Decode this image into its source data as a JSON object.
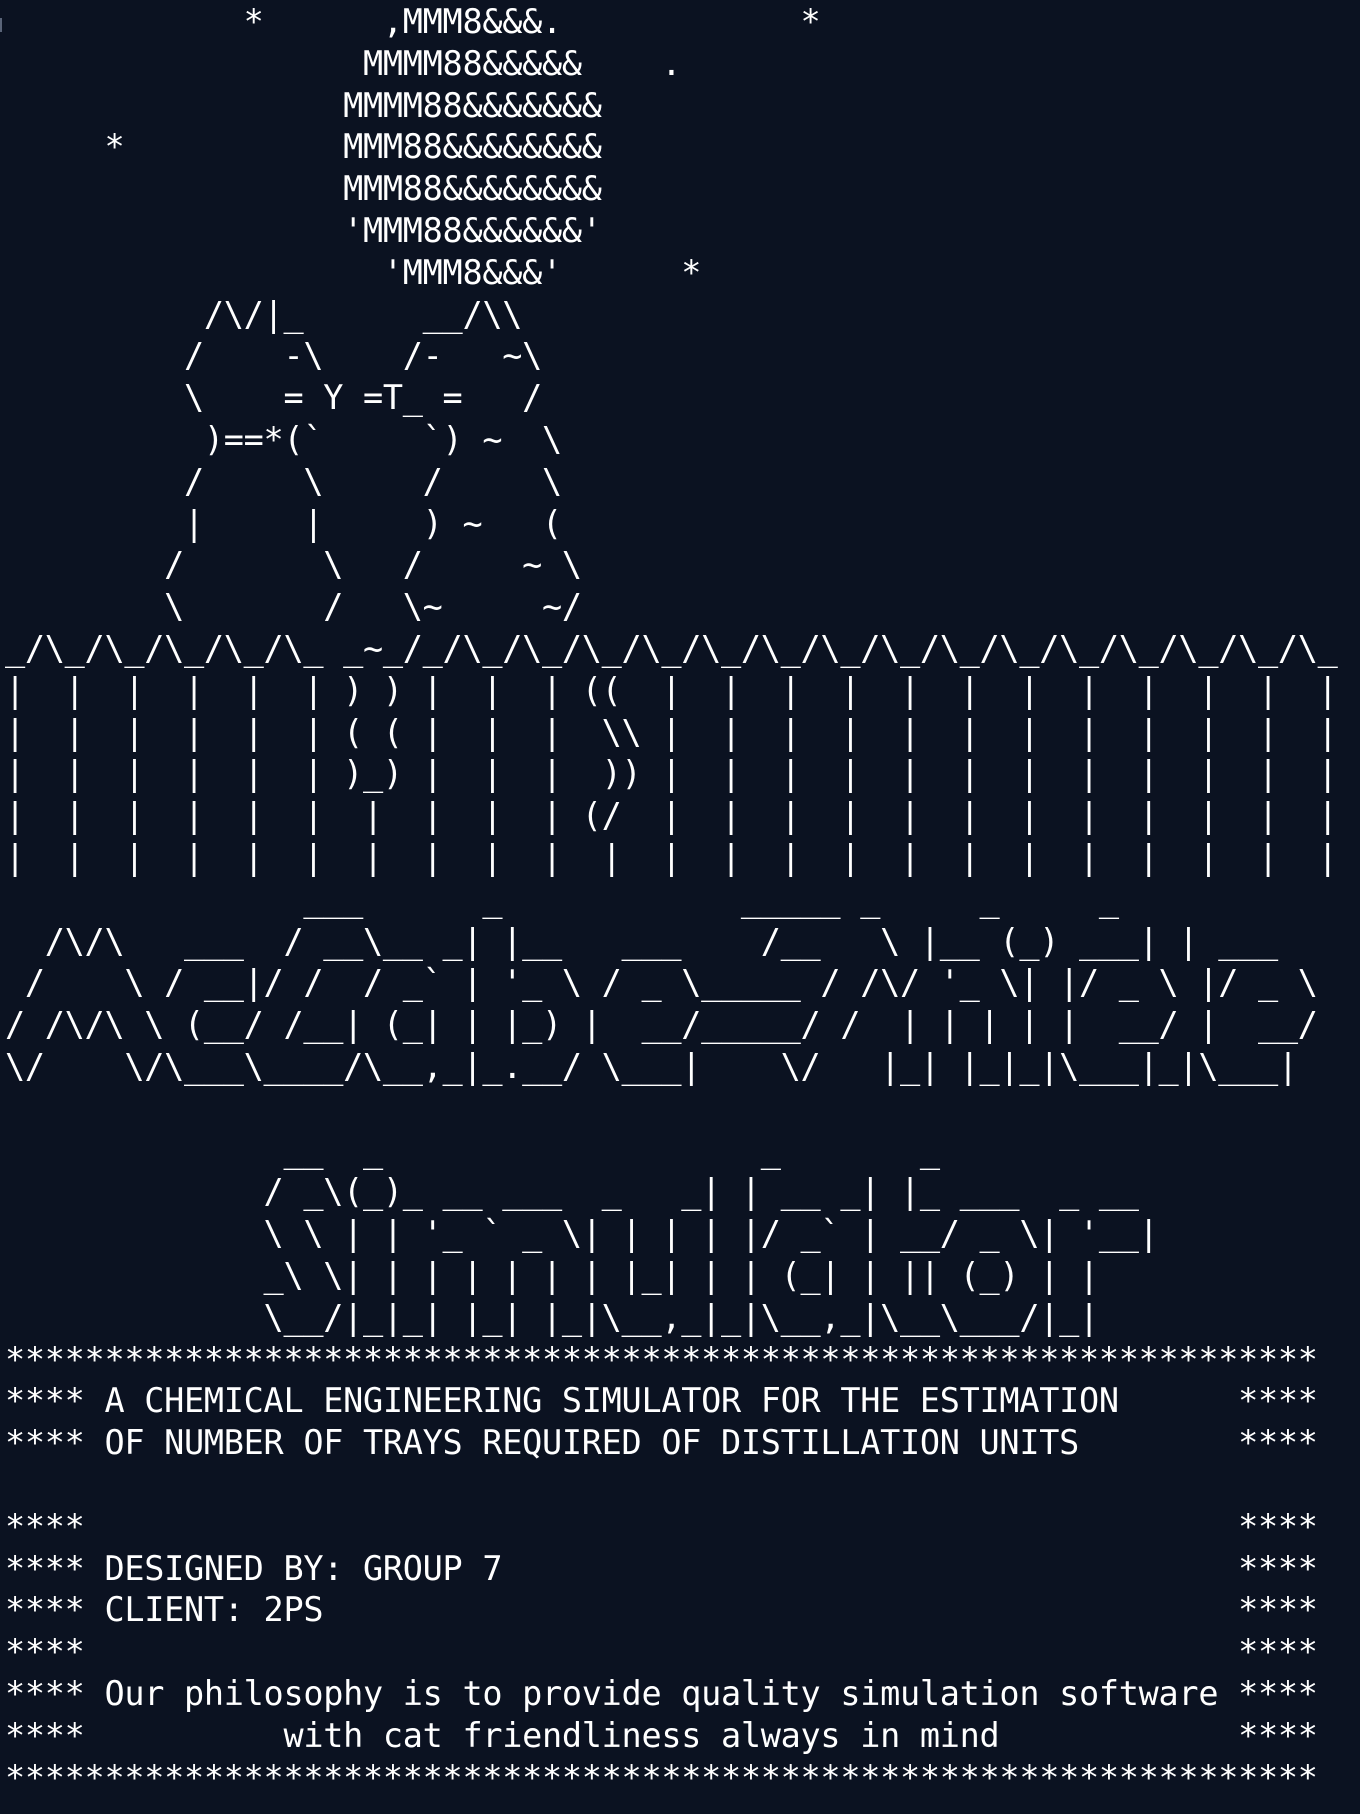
{
  "terminal": {
    "background": "#0b1221",
    "foreground": "#ffffff",
    "lines": [
      "            *      ,MMM8&&&.            *",
      "                  MMMM88&&&&&    .",
      "                 MMMM88&&&&&&&",
      "     *           MMM88&&&&&&&&",
      "                 MMM88&&&&&&&&",
      "                 'MMM88&&&&&&'",
      "                   'MMM8&&&'      *",
      "          /\\/|_      __/\\\\",
      "         /    -\\    /-   ~\\",
      "         \\    = Y =T_ =   /",
      "          )==*(`     `) ~  \\",
      "         /     \\     /     \\",
      "         |     |     ) ~   (",
      "        /       \\   /     ~ \\",
      "        \\       /   \\~     ~/",
      "_/\\_/\\_/\\_/\\_/\\_ _~_/_/\\_/\\_/\\_/\\_/\\_/\\_/\\_/\\_/\\_/\\_/\\_/\\_/\\_/\\_/\\_",
      "|  |  |  |  |  | ) ) |  |  | ((  |  |  |  |  |  |  |  |  |  |  |  |",
      "|  |  |  |  |  | ( ( |  |  |  \\\\ |  |  |  |  |  |  |  |  |  |  |  |",
      "|  |  |  |  |  | )_) |  |  |  )) |  |  |  |  |  |  |  |  |  |  |  |",
      "|  |  |  |  |  |  |  |  |  | (/  |  |  |  |  |  |  |  |  |  |  |  |",
      "|  |  |  |  |  |  |  |  |  |  |  |  |  |  |  |  |  |  |  |  |  |  |",
      "               ___      _            _____ _     _     _",
      "  /\\/\\   ___  / __\\__ _| |__   ___    /__   \\ |__ (_) ___| | ___",
      " /    \\ / __|/ /  / _` | '_ \\ / _ \\_____ / /\\/ '_ \\| |/ _ \\ |/ _ \\",
      "/ /\\/\\ \\ (__/ /__| (_| | |_) |  __/_____/ /  | | | | |  __/ |  __/",
      "\\/    \\/\\___\\____/\\__,_|_.__/ \\___|    \\/   |_| |_|_|\\___|_|\\___|",
      "",
      "              __  _                   _       _",
      "             / _\\(_)_ __ ___  _   _| | __ _| |_ ___  _ __",
      "             \\ \\ | | '_ ` _ \\| | | | |/ _` | __/ _ \\| '__|",
      "             _\\ \\| | | | | | | |_| | | (_| | || (_) | |",
      "             \\__/|_|_| |_| |_|\\__,_|_|\\__,_|\\__\\___/|_|",
      "******************************************************************",
      "**** A CHEMICAL ENGINEERING SIMULATOR FOR THE ESTIMATION      ****",
      "**** OF NUMBER OF TRAYS REQUIRED OF DISTILLATION UNITS        ****",
      "",
      "****                                                          ****",
      "**** DESIGNED BY: GROUP 7                                     ****",
      "**** CLIENT: 2PS                                              ****",
      "****                                                          ****",
      "**** Our philosophy is to provide quality simulation software ****",
      "****          with cat friendliness always in mind            ****",
      "******************************************************************"
    ]
  }
}
